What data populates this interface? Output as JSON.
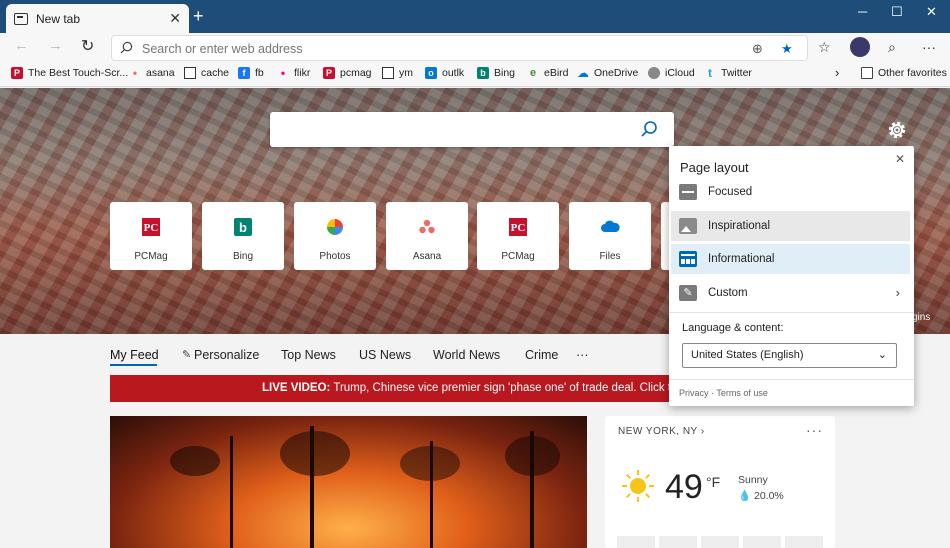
{
  "tab": {
    "title": "New tab",
    "close": "✕",
    "new": "+"
  },
  "window": {
    "minimize": "─",
    "maximize": "☐",
    "close": "✕"
  },
  "address": {
    "placeholder": "Search or enter web address"
  },
  "favorites": [
    {
      "label": "The Best Touch-Scr...",
      "color": "#c8102e",
      "glyph": "P"
    },
    {
      "label": "asana",
      "color": "#f06a6a",
      "glyph": "•"
    },
    {
      "label": "cache",
      "color": "#ffffff",
      "glyph": ""
    },
    {
      "label": "fb",
      "color": "#1877f2",
      "glyph": "f"
    },
    {
      "label": "flikr",
      "color": "#ff0084",
      "glyph": "•"
    },
    {
      "label": "pcmag",
      "color": "#c8102e",
      "glyph": "P"
    },
    {
      "label": "ym",
      "color": "#ffffff",
      "glyph": ""
    },
    {
      "label": "outlk",
      "color": "#0078d4",
      "glyph": "o"
    },
    {
      "label": "Bing",
      "color": "#008373",
      "glyph": "b"
    },
    {
      "label": "eBird",
      "color": "#4a8c3c",
      "glyph": "e"
    },
    {
      "label": "OneDrive",
      "color": "#0078d4",
      "glyph": "☁"
    },
    {
      "label": "iCloud",
      "color": "#888888",
      "glyph": ""
    },
    {
      "label": "Twitter",
      "color": "#1da1f2",
      "glyph": "t"
    }
  ],
  "other_favorites": "Other favorites",
  "tiles": [
    {
      "label": "PCMag"
    },
    {
      "label": "Bing"
    },
    {
      "label": "Photos"
    },
    {
      "label": "Asana"
    },
    {
      "label": "PCMag"
    },
    {
      "label": "Files"
    }
  ],
  "hero_credit": "gins",
  "feed_nav": [
    "My Feed",
    "Personalize",
    "Top News",
    "US News",
    "World News",
    "Crime",
    "···"
  ],
  "live": {
    "tag": "LIVE VIDEO:",
    "text": " Trump, Chinese vice premier sign 'phase one' of trade deal. Click to watch"
  },
  "weather": {
    "location": "NEW YORK, NY",
    "chevron": "›",
    "more": "···",
    "temp": "49",
    "unit": "°F",
    "condition": "Sunny",
    "precip": "20.0%"
  },
  "popup": {
    "title": "Page layout",
    "close": "✕",
    "options": [
      {
        "label": "Focused"
      },
      {
        "label": "Inspirational"
      },
      {
        "label": "Informational"
      },
      {
        "label": "Custom"
      }
    ],
    "language_label": "Language & content:",
    "language_value": "United States (English)",
    "privacy": "Privacy",
    "sep": " · ",
    "terms": "Terms of use"
  }
}
